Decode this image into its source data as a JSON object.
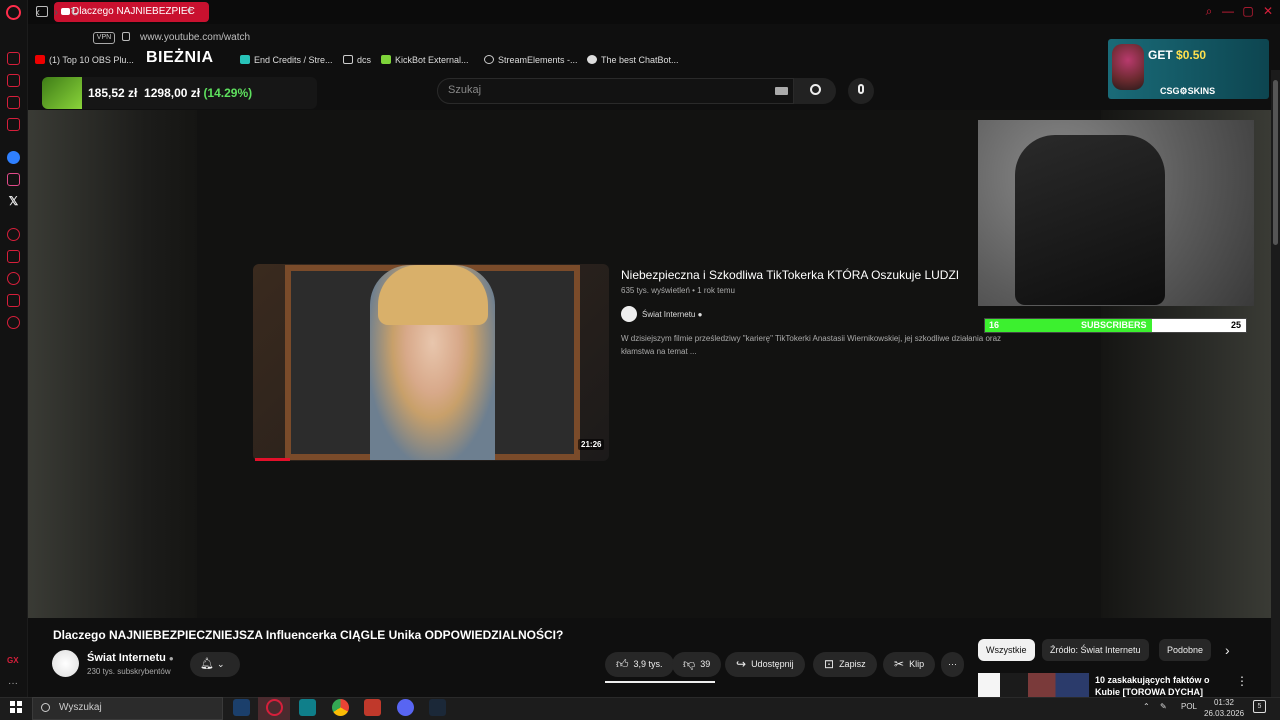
{
  "browser": {
    "tab_title": "Dlaczego NAJNIEBEZPIEC",
    "url": "www.youtube.com/watch",
    "vpn_label": "VPN",
    "bookmarks": [
      "(1) Top 10 OBS Plu...",
      "End Credits / Stre...",
      "dcs",
      "KickBot External...",
      "StreamElements -...",
      "The best ChatBot..."
    ]
  },
  "search": {
    "placeholder": "Szukaj"
  },
  "overlays": {
    "bieznia": "BIEŻNIA",
    "stock_price": "185,52 zł",
    "stock_target": "1298,00 zł",
    "stock_pct": "(14.29%)",
    "csg_get": "GET",
    "csg_amount": "$0.50",
    "csg_brand": "CSG⚙SKINS",
    "subs_current": "16",
    "subs_label": "SUBSCRIBERS",
    "subs_goal": "25",
    "subs_progress": 0.64
  },
  "end_card": {
    "title": "Niebezpieczna i Szkodliwa TikTokerka KTÓRA Oszukuje LUDZI",
    "meta": "635 tys. wyświetleń • 1 rok temu",
    "channel": "Świat Internetu",
    "description": "W dzisiejszym filmie prześledziwy \"karierę\" TikTokerki Anastasii Wiernikowskiej, jej szkodliwe działania oraz kłamstwa na temat ...",
    "duration": "21:26"
  },
  "video": {
    "title": "Dlaczego NAJNIEBEZPIECZNIEJSZA Influencerka CIĄGLE Unika ODPOWIEDZIALNOŚCI?",
    "channel": "Świat Internetu",
    "subscribers": "230 tys. subskrybentów",
    "likes": "3,9 tys.",
    "dislikes": "39",
    "share": "Udostępnij",
    "save": "Zapisz",
    "clip": "Klip"
  },
  "recommendations": {
    "chips": [
      "Wszystkie",
      "Źródło: Świat Internetu",
      "Podobne"
    ],
    "first_title": "10 zaskakujących faktów o Kubie [TOROWA DYCHA]"
  },
  "taskbar": {
    "search": "Wyszukaj",
    "lang": "POL",
    "time": "01:32",
    "date": "26.03.2026",
    "notif_count": "5"
  },
  "colors": {
    "accent": "#c9112f",
    "subs_fill": "#3cf02f",
    "stock_up": "#5ee05e"
  }
}
